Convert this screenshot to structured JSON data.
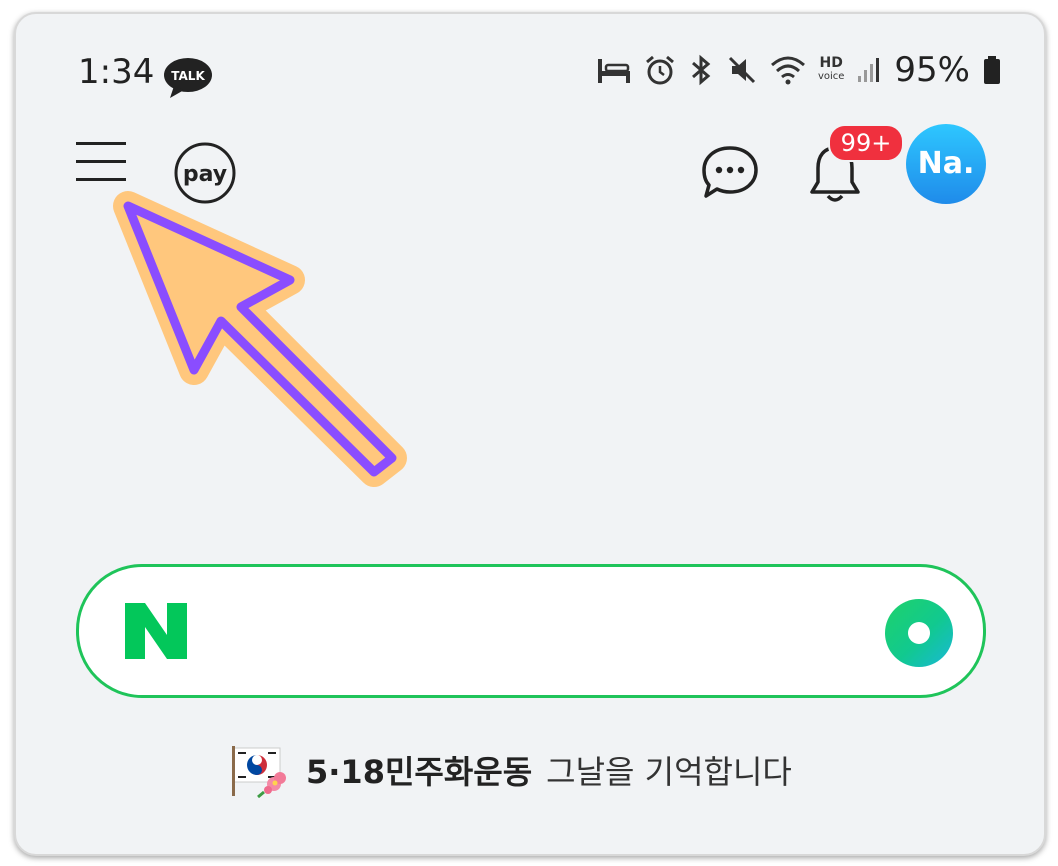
{
  "status_bar": {
    "time": "1:34",
    "talk_label": "TALK",
    "hd_label": "HD",
    "voice_label": "voice",
    "battery": "95%"
  },
  "header": {
    "pay_label": "pay",
    "notification_badge": "99+",
    "avatar_label": "Na."
  },
  "search": {
    "logo_letter": "N"
  },
  "banner": {
    "strong_text": "5·18민주화운동",
    "rest_text": "그날을 기억합니다"
  },
  "colors": {
    "background": "#f1f3f5",
    "naver_green": "#1fc45a",
    "badge_red": "#f0303e",
    "avatar_blue": "#1f8bea",
    "arrow_fill": "#ffc77d",
    "arrow_stroke": "#8a4dff"
  },
  "icons": {
    "menu": "hamburger-menu-icon",
    "pay": "pay-icon",
    "chat": "chat-bubble-icon",
    "bell": "bell-icon",
    "lens": "green-lens-icon"
  }
}
